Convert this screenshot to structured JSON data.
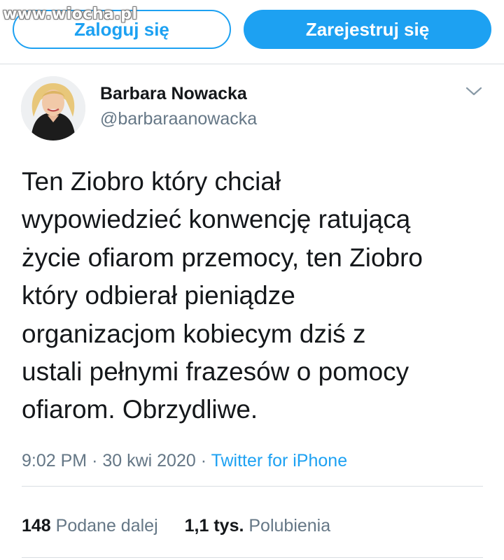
{
  "watermark": "www.wiocha.pl",
  "header": {
    "login_label": "Zaloguj się",
    "register_label": "Zarejestruj się"
  },
  "tweet": {
    "author_name": "Barbara Nowacka",
    "author_handle": "@barbaraanowacka",
    "text": "Ten Ziobro który chciał\nwypowiedzieć konwencję ratującą\nżycie ofiarom przemocy, ten Ziobro\nktóry odbierał pieniądze\norganizacjom kobiecym dziś z\nustali pełnymi frazesów o pomocy\nofiarom. Obrzydliwe.",
    "time": "9:02 PM",
    "separator": "·",
    "date": "30 kwi 2020",
    "source": "Twitter for iPhone"
  },
  "stats": {
    "retweets_count": "148",
    "retweets_label": "Podane dalej",
    "likes_count": "1,1 tys.",
    "likes_label": "Polubienia"
  },
  "colors": {
    "accent": "#1da1f2",
    "secondary_text": "#657786",
    "primary_text": "#14171a"
  },
  "icons": {
    "chevron": "chevron-down-icon"
  }
}
